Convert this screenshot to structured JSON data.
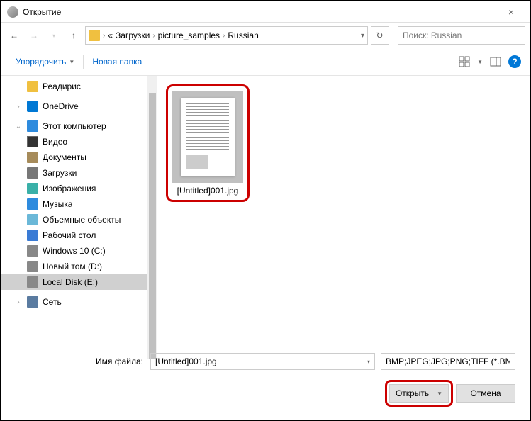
{
  "window": {
    "title": "Открытие",
    "close": "×"
  },
  "nav": {
    "crumb_arrow": "«",
    "crumb1": "Загрузки",
    "crumb2": "picture_samples",
    "crumb3": "Russian",
    "search_placeholder": "Поиск: Russian"
  },
  "toolbar": {
    "organize": "Упорядочить",
    "new_folder": "Новая папка",
    "help": "?"
  },
  "sidebar": {
    "items": [
      {
        "label": "Реадирис",
        "level": 2,
        "icon": "icon-folder"
      },
      {
        "label": "OneDrive",
        "level": 1,
        "icon": "icon-onedrive",
        "expandable": true
      },
      {
        "label": "Этот компьютер",
        "level": 1,
        "icon": "icon-pc",
        "expandable": true,
        "expanded": true
      },
      {
        "label": "Видео",
        "level": 2,
        "icon": "icon-video"
      },
      {
        "label": "Документы",
        "level": 2,
        "icon": "icon-doc"
      },
      {
        "label": "Загрузки",
        "level": 2,
        "icon": "icon-download"
      },
      {
        "label": "Изображения",
        "level": 2,
        "icon": "icon-image"
      },
      {
        "label": "Музыка",
        "level": 2,
        "icon": "icon-music"
      },
      {
        "label": "Объемные объекты",
        "level": 2,
        "icon": "icon-3d"
      },
      {
        "label": "Рабочий стол",
        "level": 2,
        "icon": "icon-desktop"
      },
      {
        "label": "Windows 10 (C:)",
        "level": 2,
        "icon": "icon-disk"
      },
      {
        "label": "Новый том (D:)",
        "level": 2,
        "icon": "icon-disk"
      },
      {
        "label": "Local Disk (E:)",
        "level": 2,
        "icon": "icon-disk",
        "selected": true
      },
      {
        "label": "Сеть",
        "level": 1,
        "icon": "icon-network",
        "expandable": true
      }
    ]
  },
  "file": {
    "name": "[Untitled]001.jpg"
  },
  "footer": {
    "filename_label": "Имя файла:",
    "filename_value": "[Untitled]001.jpg",
    "filetype": "BMP;JPEG;JPG;PNG;TIFF (*.BMP",
    "open": "Открыть",
    "cancel": "Отмена"
  }
}
